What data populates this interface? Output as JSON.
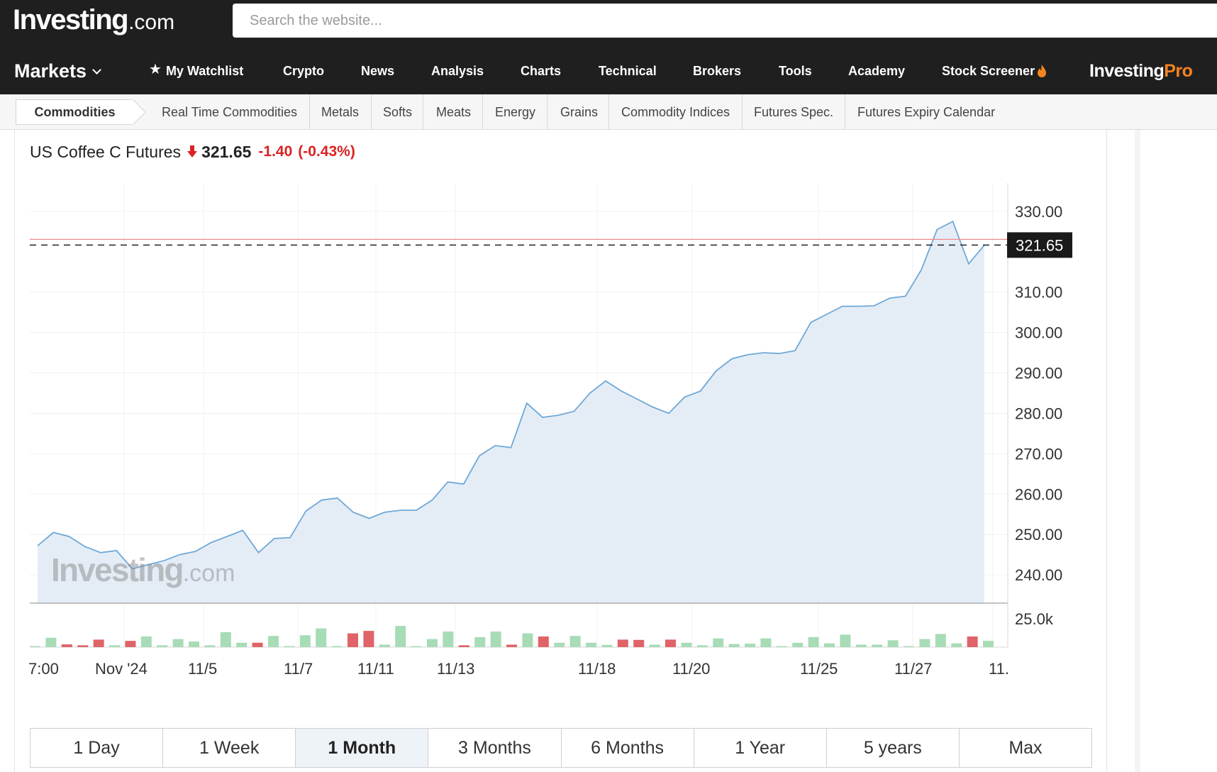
{
  "header": {
    "logo_brand": "Investing",
    "logo_tld": ".com",
    "search_placeholder": "Search the website...",
    "nav": {
      "markets": "Markets",
      "watchlist": "My Watchlist",
      "crypto": "Crypto",
      "news": "News",
      "analysis": "Analysis",
      "charts": "Charts",
      "technical": "Technical",
      "brokers": "Brokers",
      "tools": "Tools",
      "academy": "Academy",
      "screener": "Stock Screener"
    },
    "pro_logo_brand": "Investing",
    "pro_logo_accent": "Pro",
    "colors": {
      "bar_bg": "#1f1f1f",
      "pro_accent": "#f5841f"
    }
  },
  "subnav": {
    "current": "Commodities",
    "items": [
      "Real Time Commodities",
      "Metals",
      "Softs",
      "Meats",
      "Energy",
      "Grains",
      "Commodity Indices",
      "Futures Spec.",
      "Futures Expiry Calendar"
    ]
  },
  "quote": {
    "name": "US Coffee C Futures",
    "direction": "down",
    "price": "321.65",
    "change": "-1.40",
    "change_pct": "(-0.43%)",
    "down_color": "#d92323"
  },
  "watermark": {
    "brand": "Investing",
    "tld": ".com"
  },
  "chart_data": {
    "type": "area",
    "y_ticks": [
      "330.00",
      "310.00",
      "300.00",
      "290.00",
      "280.00",
      "270.00",
      "260.00",
      "250.00",
      "240.00"
    ],
    "x_ticks": [
      "7:00",
      "Nov '24",
      "11/5",
      "11/7",
      "11/11",
      "11/13",
      "11/18",
      "11/20",
      "11/25",
      "11/27",
      "11."
    ],
    "ylim": [
      233,
      337
    ],
    "current_price_label": "321.65",
    "current_price": 321.65,
    "prev_close_line": 323.05,
    "volume_axis_label": "25.0k",
    "volume_max": 25000,
    "series": [
      {
        "values": [
          247.2,
          250.5,
          249.5,
          247.0,
          245.5,
          246.0,
          241.5,
          242.5,
          243.5,
          245.0,
          245.8,
          248.0,
          249.5,
          251.0,
          245.5,
          249.0,
          249.2,
          255.8,
          258.5,
          259.0,
          255.5,
          254.0,
          255.5,
          256.0,
          256.0,
          258.5,
          263.0,
          262.5,
          269.5,
          272.0,
          271.5,
          282.5,
          279.0,
          279.5,
          280.5,
          285.0,
          288.0,
          285.5,
          283.5,
          281.5,
          280.0,
          284.0,
          285.5,
          290.5,
          293.5,
          294.5,
          295.0,
          294.8,
          295.5,
          302.5,
          304.5,
          306.5,
          306.5,
          306.6,
          308.5,
          309.0,
          315.5,
          325.5,
          327.5,
          317.0,
          321.65
        ]
      }
    ],
    "volume": [
      {
        "dir": "up",
        "v": 800
      },
      {
        "dir": "up",
        "v": 7500
      },
      {
        "dir": "down",
        "v": 2200
      },
      {
        "dir": "down",
        "v": 1500
      },
      {
        "dir": "down",
        "v": 6000
      },
      {
        "dir": "up",
        "v": 1500
      },
      {
        "dir": "down",
        "v": 5000
      },
      {
        "dir": "up",
        "v": 8500
      },
      {
        "dir": "up",
        "v": 1500
      },
      {
        "dir": "up",
        "v": 6500
      },
      {
        "dir": "up",
        "v": 4500
      },
      {
        "dir": "up",
        "v": 1500
      },
      {
        "dir": "up",
        "v": 12000
      },
      {
        "dir": "up",
        "v": 3500
      },
      {
        "dir": "down",
        "v": 3500
      },
      {
        "dir": "up",
        "v": 9000
      },
      {
        "dir": "up",
        "v": 800
      },
      {
        "dir": "up",
        "v": 9500
      },
      {
        "dir": "up",
        "v": 15000
      },
      {
        "dir": "up",
        "v": 800
      },
      {
        "dir": "down",
        "v": 11000
      },
      {
        "dir": "down",
        "v": 13000
      },
      {
        "dir": "up",
        "v": 2000
      },
      {
        "dir": "up",
        "v": 17000
      },
      {
        "dir": "up",
        "v": 800
      },
      {
        "dir": "up",
        "v": 6500
      },
      {
        "dir": "up",
        "v": 12500
      },
      {
        "dir": "down",
        "v": 1500
      },
      {
        "dir": "up",
        "v": 8000
      },
      {
        "dir": "up",
        "v": 12500
      },
      {
        "dir": "down",
        "v": 2000
      },
      {
        "dir": "up",
        "v": 11000
      },
      {
        "dir": "down",
        "v": 8500
      },
      {
        "dir": "up",
        "v": 3500
      },
      {
        "dir": "up",
        "v": 9000
      },
      {
        "dir": "up",
        "v": 3500
      },
      {
        "dir": "up",
        "v": 1800
      },
      {
        "dir": "down",
        "v": 6000
      },
      {
        "dir": "down",
        "v": 5800
      },
      {
        "dir": "up",
        "v": 2000
      },
      {
        "dir": "down",
        "v": 6000
      },
      {
        "dir": "up",
        "v": 3500
      },
      {
        "dir": "up",
        "v": 1500
      },
      {
        "dir": "up",
        "v": 7000
      },
      {
        "dir": "up",
        "v": 2500
      },
      {
        "dir": "up",
        "v": 2800
      },
      {
        "dir": "up",
        "v": 7000
      },
      {
        "dir": "up",
        "v": 800
      },
      {
        "dir": "up",
        "v": 3500
      },
      {
        "dir": "up",
        "v": 8000
      },
      {
        "dir": "up",
        "v": 3000
      },
      {
        "dir": "up",
        "v": 10000
      },
      {
        "dir": "up",
        "v": 2000
      },
      {
        "dir": "up",
        "v": 2000
      },
      {
        "dir": "up",
        "v": 5500
      },
      {
        "dir": "up",
        "v": 800
      },
      {
        "dir": "up",
        "v": 6500
      },
      {
        "dir": "up",
        "v": 10500
      },
      {
        "dir": "up",
        "v": 3000
      },
      {
        "dir": "down",
        "v": 8500
      },
      {
        "dir": "up",
        "v": 5000
      }
    ],
    "colors": {
      "line": "#6fa8d6",
      "area": "#e4edf6",
      "prev_close": "#f08a8a",
      "vol_up": "#a7dcb6",
      "vol_down": "#e06367",
      "price_tag_bg": "#1a1a1a"
    }
  },
  "ranges": {
    "items": [
      "1 Day",
      "1 Week",
      "1 Month",
      "3 Months",
      "6 Months",
      "1 Year",
      "5 years",
      "Max"
    ],
    "active": "1 Month"
  }
}
